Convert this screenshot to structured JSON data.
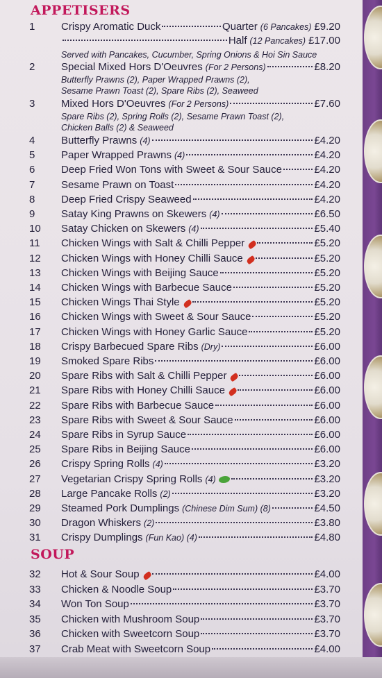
{
  "appetisers": {
    "title": "APPETISERS",
    "duck": {
      "number": "1",
      "name": "Crispy Aromatic Duck",
      "quarter_label": "Quarter",
      "quarter_note": "(6 Pancakes)",
      "quarter_price": "£9.20",
      "half_label": "Half",
      "half_note": "(12 Pancakes)",
      "half_price": "£17.00",
      "served": "Served with Pancakes, Cucumber, Spring Onions & Hoi Sin Sauce"
    },
    "item2": {
      "number": "2",
      "name": "Special Mixed Hors D'Oeuvres",
      "note": "(For 2 Persons)",
      "price": "£8.20",
      "desc1": "Butterfly Prawns (2), Paper Wrapped Prawns (2),",
      "desc2": "Sesame Prawn Toast (2), Spare Ribs (2), Seaweed"
    },
    "item3": {
      "number": "3",
      "name": "Mixed Hors D'Oeuvres",
      "note": "(For 2 Persons)",
      "price": "£7.60",
      "desc1": "Spare Ribs (2), Spring Rolls (2), Sesame Prawn Toast (2),",
      "desc2": "Chicken Balls (2) & Seaweed"
    },
    "items": [
      {
        "number": "4",
        "name": "Butterfly Prawns",
        "note": "(4)",
        "price": "£4.20",
        "icon": ""
      },
      {
        "number": "5",
        "name": "Paper Wrapped Prawns",
        "note": "(4)",
        "price": "£4.20",
        "icon": ""
      },
      {
        "number": "6",
        "name": "Deep Fried Won Tons with Sweet & Sour Sauce",
        "note": "",
        "price": "£4.20",
        "icon": ""
      },
      {
        "number": "7",
        "name": "Sesame Prawn on Toast",
        "note": "",
        "price": "£4.20",
        "icon": ""
      },
      {
        "number": "8",
        "name": "Deep Fried Crispy Seaweed",
        "note": "",
        "price": "£4.20",
        "icon": ""
      },
      {
        "number": "9",
        "name": "Satay King Prawns on Skewers",
        "note": "(4)",
        "price": "£6.50",
        "icon": ""
      },
      {
        "number": "10",
        "name": "Satay Chicken on Skewers",
        "note": "(4)",
        "price": "£5.40",
        "icon": ""
      },
      {
        "number": "11",
        "name": "Chicken Wings with Salt & Chilli Pepper",
        "note": "",
        "price": "£5.20",
        "icon": "chili-icon"
      },
      {
        "number": "12",
        "name": "Chicken Wings with Honey Chilli Sauce",
        "note": "",
        "price": "£5.20",
        "icon": "chili-icon"
      },
      {
        "number": "13",
        "name": "Chicken Wings with Beijing Sauce",
        "note": "",
        "price": "£5.20",
        "icon": ""
      },
      {
        "number": "14",
        "name": "Chicken Wings with Barbecue Sauce",
        "note": "",
        "price": "£5.20",
        "icon": ""
      },
      {
        "number": "15",
        "name": "Chicken Wings Thai Style",
        "note": "",
        "price": "£5.20",
        "icon": "chili-icon"
      },
      {
        "number": "16",
        "name": "Chicken Wings with Sweet & Sour Sauce",
        "note": "",
        "price": "£5.20",
        "icon": ""
      },
      {
        "number": "17",
        "name": "Chicken Wings with Honey Garlic Sauce",
        "note": "",
        "price": "£5.20",
        "icon": ""
      },
      {
        "number": "18",
        "name": "Crispy Barbecued Spare Ribs",
        "note": "(Dry)",
        "price": "£6.00",
        "icon": ""
      },
      {
        "number": "19",
        "name": "Smoked Spare Ribs",
        "note": "",
        "price": "£6.00",
        "icon": ""
      },
      {
        "number": "20",
        "name": "Spare Ribs with Salt & Chilli Pepper",
        "note": "",
        "price": "£6.00",
        "icon": "chili-icon"
      },
      {
        "number": "21",
        "name": "Spare Ribs with Honey Chilli Sauce",
        "note": "",
        "price": "£6.00",
        "icon": "chili-icon"
      },
      {
        "number": "22",
        "name": "Spare Ribs with Barbecue Sauce",
        "note": "",
        "price": "£6.00",
        "icon": ""
      },
      {
        "number": "23",
        "name": "Spare Ribs with Sweet & Sour Sauce",
        "note": "",
        "price": "£6.00",
        "icon": ""
      },
      {
        "number": "24",
        "name": "Spare Ribs in Syrup Sauce",
        "note": "",
        "price": "£6.00",
        "icon": ""
      },
      {
        "number": "25",
        "name": "Spare Ribs in Beijing Sauce",
        "note": "",
        "price": "£6.00",
        "icon": ""
      },
      {
        "number": "26",
        "name": "Crispy Spring Rolls",
        "note": "(4)",
        "price": "£3.20",
        "icon": ""
      },
      {
        "number": "27",
        "name": "Vegetarian Crispy Spring Rolls",
        "note": "(4)",
        "price": "£3.20",
        "icon": "vegetarian-icon"
      },
      {
        "number": "28",
        "name": "Large Pancake Rolls",
        "note": "(2)",
        "price": "£3.20",
        "icon": ""
      },
      {
        "number": "29",
        "name": "Steamed Pork Dumplings",
        "note": "(Chinese Dim Sum) (8)",
        "price": "£4.50",
        "icon": ""
      },
      {
        "number": "30",
        "name": "Dragon Whiskers",
        "note": "(2)",
        "price": "£3.80",
        "icon": ""
      },
      {
        "number": "31",
        "name": "Crispy Dumplings",
        "note": "(Fun Kao) (4)",
        "price": "£4.80",
        "icon": ""
      }
    ]
  },
  "soup": {
    "title": "SOUP",
    "items": [
      {
        "number": "32",
        "name": "Hot & Sour Soup",
        "note": "",
        "price": "£4.00",
        "icon": "chili-icon"
      },
      {
        "number": "33",
        "name": "Chicken & Noodle Soup",
        "note": "",
        "price": "£3.70",
        "icon": ""
      },
      {
        "number": "34",
        "name": "Won Ton Soup",
        "note": "",
        "price": "£3.70",
        "icon": ""
      },
      {
        "number": "35",
        "name": "Chicken with Mushroom Soup",
        "note": "",
        "price": "£3.70",
        "icon": ""
      },
      {
        "number": "36",
        "name": "Chicken with Sweetcorn Soup",
        "note": "",
        "price": "£3.70",
        "icon": ""
      },
      {
        "number": "37",
        "name": "Crab Meat with Sweetcorn Soup",
        "note": "",
        "price": "£4.00",
        "icon": ""
      }
    ]
  },
  "colors": {
    "heading": "#c2185b",
    "text": "#24203a",
    "panel": "#7a4793",
    "chili": "#d22f1f",
    "vegetarian": "#4aa33a"
  }
}
